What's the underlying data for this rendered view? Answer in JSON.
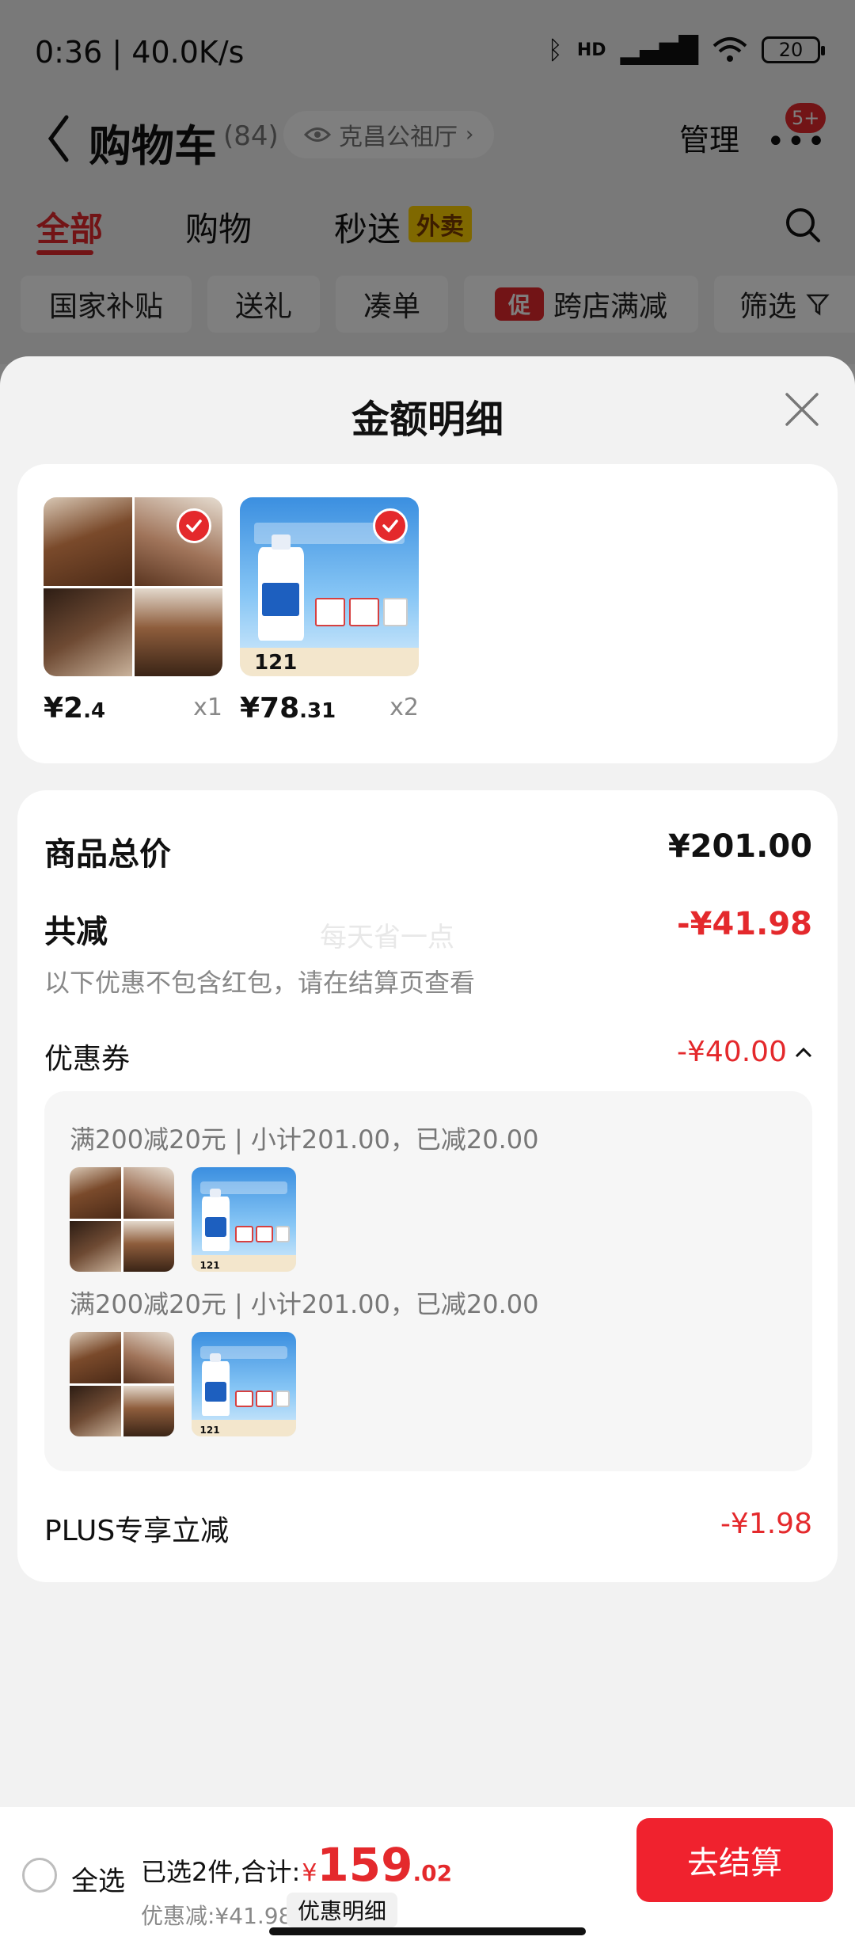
{
  "status_bar": {
    "time": "0:36 | 40.0K/s",
    "battery": "20",
    "signal_label": "HD"
  },
  "cart_header": {
    "title": "购物车",
    "count": "(84)",
    "location": "克昌公祖厅",
    "manage": "管理",
    "more_badge": "5+"
  },
  "tabs": {
    "all": "全部",
    "shop": "购物",
    "express": "秒送",
    "express_badge": "外卖"
  },
  "filters": {
    "subsidy": "国家补贴",
    "gift": "送礼",
    "bundle": "凑单",
    "promo_icon": "促",
    "cross_store": "跨店满减",
    "filter": "筛选"
  },
  "sheet": {
    "title": "金额明细",
    "products": [
      {
        "image": "hair-clip-photo",
        "price_int": "¥2",
        "price_dec": ".4",
        "qty": "x1"
      },
      {
        "image": "cerave-lotion-photo",
        "price_int": "¥78",
        "price_dec": ".31",
        "qty": "x2",
        "image_price": "121"
      }
    ],
    "summary": {
      "total_label": "商品总价",
      "total_value": "¥201.00",
      "reduce_label": "共减",
      "reduce_value": "-¥41.98",
      "reduce_note": "以下优惠不包含红包，请在结算页查看",
      "watermark": "每天省一点",
      "coupon_label": "优惠券",
      "coupon_value": "-¥40.00",
      "coupon_lines": [
        "满200减20元 | 小计201.00，已减20.00",
        "满200减20元 | 小计201.00，已减20.00"
      ],
      "plus_label": "PLUS专享立减",
      "plus_value": "-¥1.98"
    }
  },
  "bottom_bar": {
    "select_all": "全选",
    "selected_text": "已选2件,合计:",
    "currency": "¥",
    "total_int": "159",
    "total_dec": ".02",
    "discount_text": "优惠减:¥41.98",
    "detail_button": "优惠明细",
    "checkout": "去结算"
  },
  "colors": {
    "accent": "#e4292c",
    "checkout": "#f0222e",
    "badge_yellow": "#ffd100"
  }
}
